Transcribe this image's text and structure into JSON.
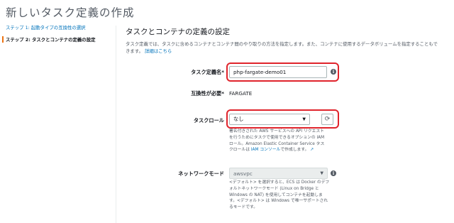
{
  "page": {
    "title": "新しいタスク定義の作成"
  },
  "sidebar": {
    "step1": "ステップ 1: 起動タイプの互換性の選択",
    "step2": "ステップ 2: タスクとコンテナの定義の設定"
  },
  "section": {
    "title": "タスクとコンテナの定義の設定",
    "description": "タスク定義では、タスクに含めるコンテナとコンテナ間のやり取りの方法を指定します。また、コンテナに使用するデータボリュームを指定することもできます。",
    "details_link": "詳細はこちら"
  },
  "form": {
    "task_def_name": {
      "label": "タスク定義名*",
      "value": "php-fargate-demo01"
    },
    "compat": {
      "label": "互換性が必要*",
      "value": "FARGATE"
    },
    "task_role": {
      "label": "タスクロール",
      "value": "なし",
      "help_part1": "署名付きされた AWS サービスへの API リクエスト を行うためにタスクで使用できるオプションの IAM ロール。Amazon Elastic Container Service タスクロールは",
      "help_link": "IAM コンソール",
      "help_part2": "で作成します。"
    },
    "network_mode": {
      "label": "ネットワークモード",
      "value": "awsvpc",
      "help": "<デフォルト> を選択すると、ECS は Docker のデフォルトネットワークモード (Linux on Bridge と Windows の NAT) を使用してコンテナを起動します。<デフォルト> は Windows で唯一サポートされるモードです。"
    }
  },
  "colors": {
    "link": "#0073bb",
    "highlight": "#e0242c",
    "step_accent": "#ec7211"
  },
  "icons": {
    "info": "info-icon",
    "refresh": "refresh-icon",
    "caret": "caret-down-icon",
    "external": "external-link-icon"
  }
}
